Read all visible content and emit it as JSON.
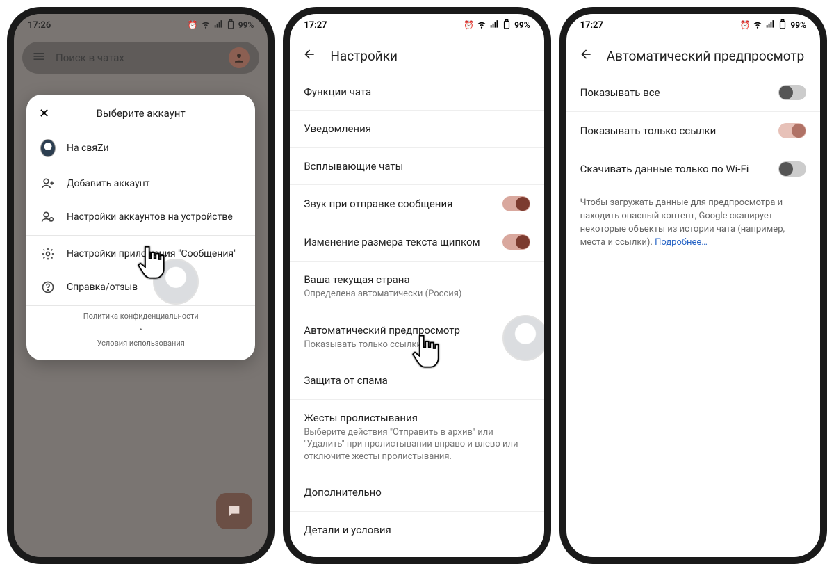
{
  "phone1": {
    "time": "17:26",
    "battery": "99%",
    "search_placeholder": "Поиск в чатах",
    "sheet": {
      "title": "Выберите аккаунт",
      "account_name": "На свяZи",
      "add_account": "Добавить аккаунт",
      "device_accounts": "Настройки аккаунтов на устройстве",
      "app_settings": "Настройки приложения \"Сообщения\"",
      "help": "Справка/отзыв",
      "privacy": "Политика конфиденциальности",
      "terms": "Условия использования"
    }
  },
  "phone2": {
    "time": "17:27",
    "battery": "99%",
    "title": "Настройки",
    "rows": {
      "chat_features": "Функции чата",
      "notifications": "Уведомления",
      "bubbles": "Всплывающие чаты",
      "send_sound": "Звук при отправке сообщения",
      "pinch_text": "Изменение размера текста щипком",
      "country_title": "Ваша текущая страна",
      "country_sub": "Определена автоматически (Россия)",
      "auto_preview_title": "Автоматический предпросмотр",
      "auto_preview_sub": "Показывать только ссылки",
      "spam": "Защита от спама",
      "swipe_title": "Жесты пролистывания",
      "swipe_sub": "Выберите действия \"Отправить в архив\" или \"Удалить\" при пролистывании вправо и влево или отключите жесты пролистывания.",
      "advanced": "Дополнительно",
      "about": "Детали и условия"
    }
  },
  "phone3": {
    "time": "17:27",
    "battery": "99%",
    "title": "Автоматический предпросмотр",
    "rows": {
      "show_all": "Показывать все",
      "only_links": "Показывать только ссылки",
      "wifi_only": "Скачивать данные только по Wi-Fi"
    },
    "info": "Чтобы загружать данные для предпросмотра и находить опасный контент, Google сканирует некоторые объекты из истории чата (например, места и ссылки). ",
    "learn_more": "Подробнее…"
  },
  "icons": {
    "alarm": "alarm-icon",
    "wifi": "wifi-icon",
    "signal": "signal-icon",
    "battery": "battery-icon"
  },
  "colors": {
    "accent": "#7c3b2f",
    "accent_light": "#d9a89e"
  }
}
